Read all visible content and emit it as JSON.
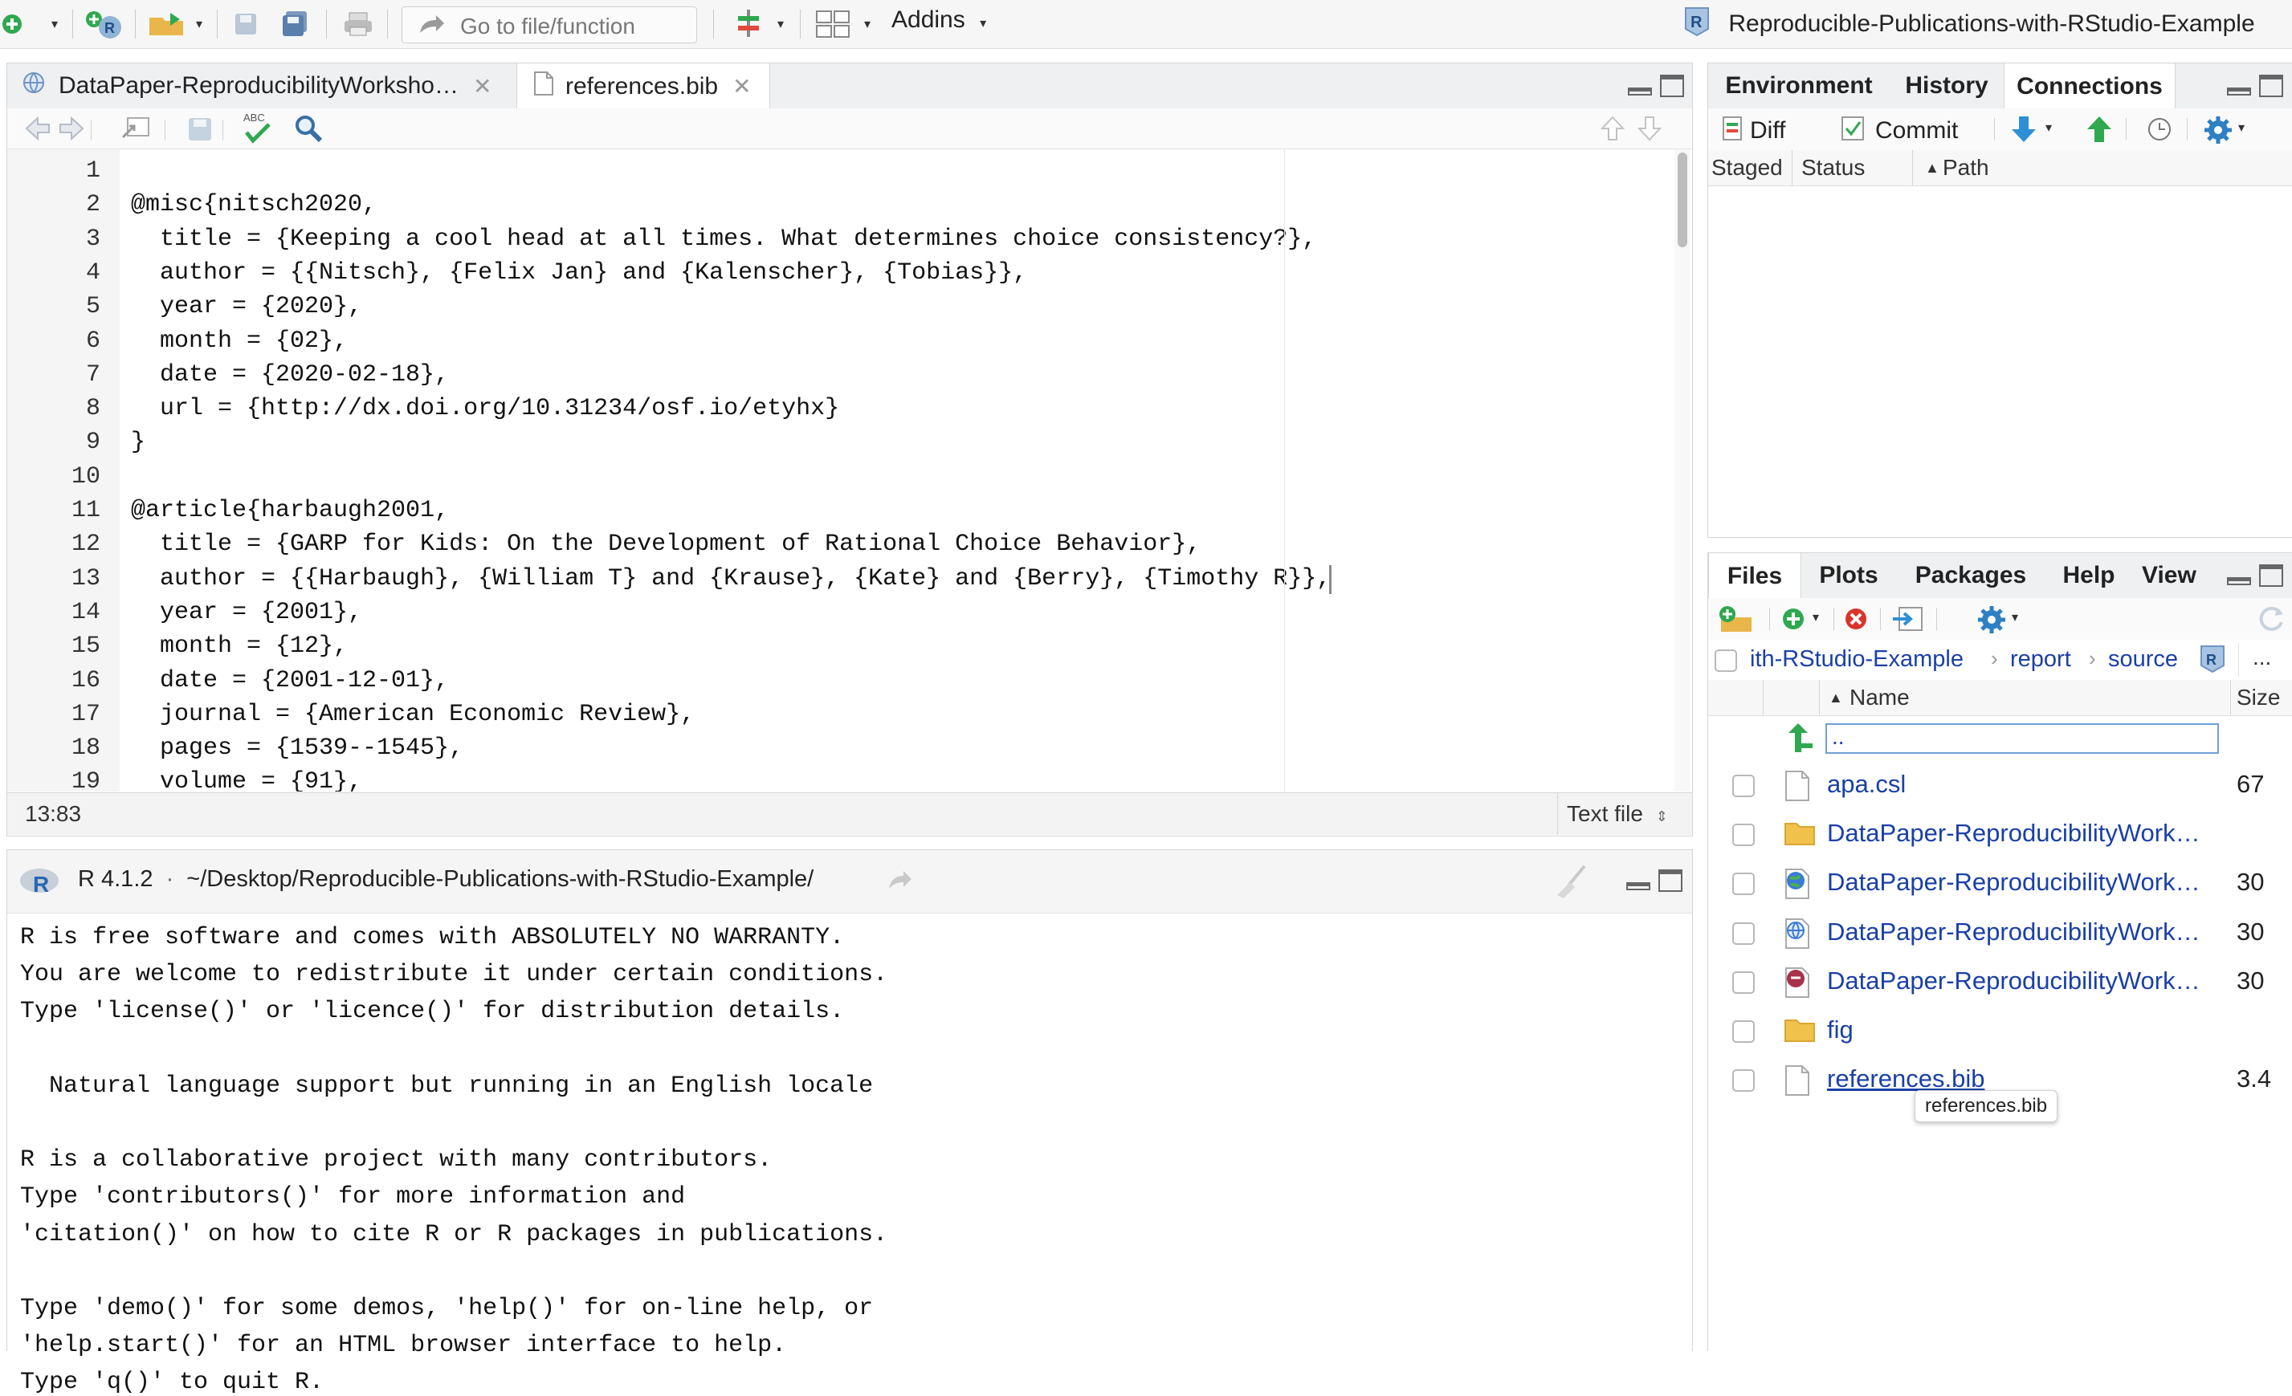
{
  "toolbar": {
    "goto_placeholder": "Go to file/function",
    "addins_label": "Addins",
    "project_name": "Reproducible-Publications-with-RStudio-Example"
  },
  "editor": {
    "tabs": [
      {
        "label": "DataPaper-ReproducibilityWorksho…",
        "active": false
      },
      {
        "label": "references.bib",
        "active": true
      }
    ],
    "lines": [
      {
        "n": "1",
        "text": ""
      },
      {
        "n": "2",
        "text": "@misc{nitsch2020,"
      },
      {
        "n": "3",
        "text": "  title = {Keeping a cool head at all times. What determines choice consistency?},"
      },
      {
        "n": "4",
        "text": "  author = {{Nitsch}, {Felix Jan} and {Kalenscher}, {Tobias}},"
      },
      {
        "n": "5",
        "text": "  year = {2020},"
      },
      {
        "n": "6",
        "text": "  month = {02},"
      },
      {
        "n": "7",
        "text": "  date = {2020-02-18},"
      },
      {
        "n": "8",
        "text": "  url = {http://dx.doi.org/10.31234/osf.io/etyhx}"
      },
      {
        "n": "9",
        "text": "}"
      },
      {
        "n": "10",
        "text": ""
      },
      {
        "n": "11",
        "text": "@article{harbaugh2001,"
      },
      {
        "n": "12",
        "text": "  title = {GARP for Kids: On the Development of Rational Choice Behavior},"
      },
      {
        "n": "13",
        "text": "  author = {{Harbaugh}, {William T} and {Krause}, {Kate} and {Berry}, {Timothy R}},"
      },
      {
        "n": "14",
        "text": "  year = {2001},"
      },
      {
        "n": "15",
        "text": "  month = {12},"
      },
      {
        "n": "16",
        "text": "  date = {2001-12-01},"
      },
      {
        "n": "17",
        "text": "  journal = {American Economic Review},"
      },
      {
        "n": "18",
        "text": "  pages = {1539--1545},"
      },
      {
        "n": "19",
        "text": "  volume = {91},"
      }
    ],
    "cursor_position": "13:83",
    "file_type": "Text file"
  },
  "console": {
    "r_version": "R 4.1.2",
    "working_dir": "~/Desktop/Reproducible-Publications-with-RStudio-Example/",
    "lines": [
      "R is free software and comes with ABSOLUTELY NO WARRANTY.",
      "You are welcome to redistribute it under certain conditions.",
      "Type 'license()' or 'licence()' for distribution details.",
      "",
      "  Natural language support but running in an English locale",
      "",
      "R is a collaborative project with many contributors.",
      "Type 'contributors()' for more information and",
      "'citation()' on how to cite R or R packages in publications.",
      "",
      "Type 'demo()' for some demos, 'help()' for on-line help, or",
      "'help.start()' for an HTML browser interface to help.",
      "Type 'q()' to quit R."
    ]
  },
  "env_pane": {
    "tabs": [
      "Environment",
      "History",
      "Connections"
    ],
    "git_diff": "Diff",
    "git_commit": "Commit",
    "columns": {
      "staged": "Staged",
      "status": "Status",
      "path": "Path"
    }
  },
  "files_pane": {
    "tabs": [
      "Files",
      "Plots",
      "Packages",
      "Help",
      "View"
    ],
    "breadcrumb": [
      "ith-RStudio-Example",
      "report",
      "source"
    ],
    "more": "...",
    "columns": {
      "name": "Name",
      "size": "Size"
    },
    "parent_dir": "..",
    "files": [
      {
        "name": "apa.csl",
        "size": "67",
        "icon": "file-icon"
      },
      {
        "name": "DataPaper-ReproducibilityWork…",
        "size": "",
        "icon": "folder-icon"
      },
      {
        "name": "DataPaper-ReproducibilityWork…",
        "size": "30",
        "icon": "html-file-icon"
      },
      {
        "name": "DataPaper-ReproducibilityWork…",
        "size": "30",
        "icon": "web-file-icon"
      },
      {
        "name": "DataPaper-ReproducibilityWork…",
        "size": "30",
        "icon": "rmd-file-icon"
      },
      {
        "name": "fig",
        "size": "",
        "icon": "folder-icon"
      },
      {
        "name": "references.bib",
        "size": "3.4",
        "icon": "file-icon"
      }
    ],
    "tooltip": "references.bib"
  }
}
